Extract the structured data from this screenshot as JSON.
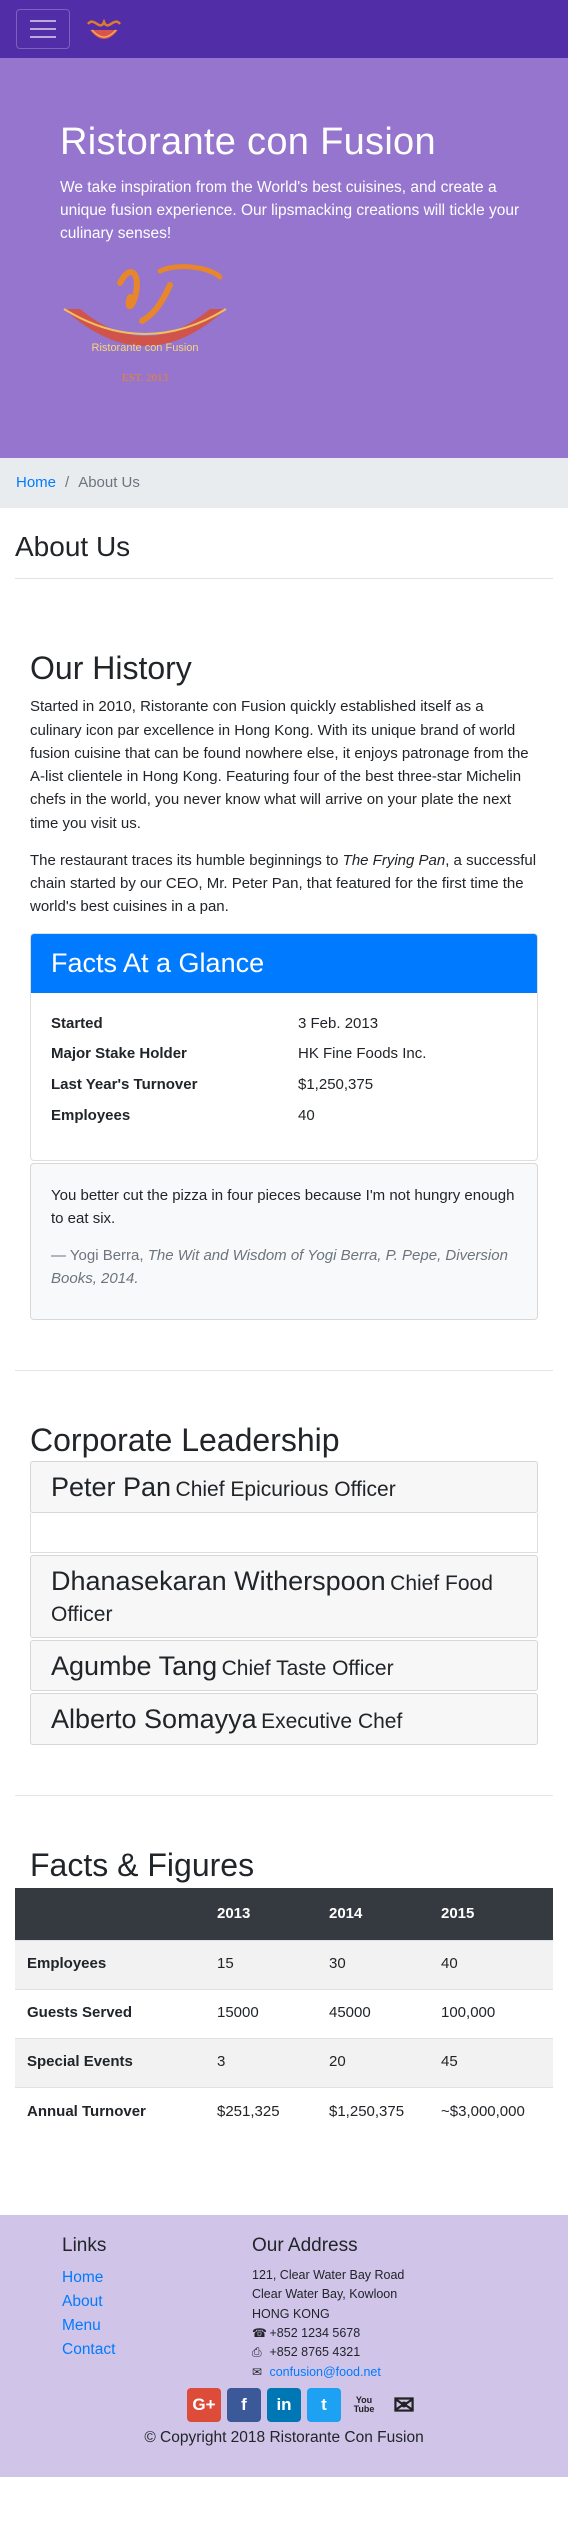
{
  "brand": {
    "title": "Ristorante con Fusion",
    "tagline": "We take inspiration from the World's best cuisines, and create a unique fusion experience. Our lipsmacking creations will tickle your culinary senses!",
    "logo_text": "Ristorante con Fusion",
    "logo_est": "EST. 2013",
    "navbar_color": "#512DA8",
    "jumbotron_color": "#9575CD",
    "footer_color": "#D1C4E9"
  },
  "breadcrumb": {
    "home": "Home",
    "separator": "/",
    "current": "About Us"
  },
  "page_title": "About Us",
  "history": {
    "title": "Our History",
    "para1": "Started in 2010, Ristorante con Fusion quickly established itself as a culinary icon par excellence in Hong Kong. With its unique brand of world fusion cuisine that can be found nowhere else, it enjoys patronage from the A-list clientele in Hong Kong. Featuring four of the best three-star Michelin chefs in the world, you never know what will arrive on your plate the next time you visit us.",
    "para2_before": "The restaurant traces its humble beginnings to ",
    "para2_em": "The Frying Pan",
    "para2_after": ", a successful chain started by our CEO, Mr. Peter Pan, that featured for the first time the world's best cuisines in a pan."
  },
  "facts": {
    "header": "Facts At a Glance",
    "rows": [
      {
        "label": "Started",
        "value": "3 Feb. 2013"
      },
      {
        "label": "Major Stake Holder",
        "value": "HK Fine Foods Inc."
      },
      {
        "label": "Last Year's Turnover",
        "value": "$1,250,375"
      },
      {
        "label": "Employees",
        "value": "40"
      }
    ]
  },
  "quote": {
    "text": "You better cut the pizza in four pieces because I'm not hungry enough to eat six.",
    "author": "— Yogi Berra, ",
    "source": "The Wit and Wisdom of Yogi Berra, P. Pepe, Diversion Books, 2014."
  },
  "leadership": {
    "title": "Corporate Leadership",
    "leaders": [
      {
        "name": "Peter Pan",
        "role": "Chief Epicurious Officer"
      },
      {
        "name": "Dhanasekaran Witherspoon",
        "role": "Chief Food Officer"
      },
      {
        "name": "Agumbe Tang",
        "role": "Chief Taste Officer"
      },
      {
        "name": "Alberto Somayya",
        "role": "Executive Chef"
      }
    ]
  },
  "figures": {
    "title": "Facts & Figures",
    "columns": [
      "",
      "2013",
      "2014",
      "2015"
    ],
    "rows": [
      {
        "label": "Employees",
        "values": [
          "15",
          "30",
          "40"
        ]
      },
      {
        "label": "Guests Served",
        "values": [
          "15000",
          "45000",
          "100,000"
        ]
      },
      {
        "label": "Special Events",
        "values": [
          "3",
          "20",
          "45"
        ]
      },
      {
        "label": "Annual Turnover",
        "values": [
          "$251,325",
          "$1,250,375",
          "~$3,000,000"
        ]
      }
    ]
  },
  "footer": {
    "links_title": "Links",
    "links": [
      "Home",
      "About",
      "Menu",
      "Contact"
    ],
    "address_title": "Our Address",
    "address_lines": [
      "121, Clear Water Bay Road",
      "Clear Water Bay, Kowloon",
      "HONG KONG"
    ],
    "phone": "+852 1234 5678",
    "fax": "+852 8765 4321",
    "email": "confusion@food.net",
    "social": [
      {
        "icon": "google-plus-icon",
        "label": "G+",
        "color": "#dd4b39"
      },
      {
        "icon": "facebook-icon",
        "label": "f",
        "color": "#3b5998"
      },
      {
        "icon": "linkedin-icon",
        "label": "in",
        "color": "#0077b5"
      },
      {
        "icon": "twitter-icon",
        "label": "t",
        "color": "#1da1f2"
      },
      {
        "icon": "youtube-icon",
        "label": "You Tube",
        "color": "#222222"
      },
      {
        "icon": "mail-icon",
        "label": "✉",
        "color": "#222222"
      }
    ],
    "copyright": "© Copyright 2018 Ristorante Con Fusion"
  }
}
